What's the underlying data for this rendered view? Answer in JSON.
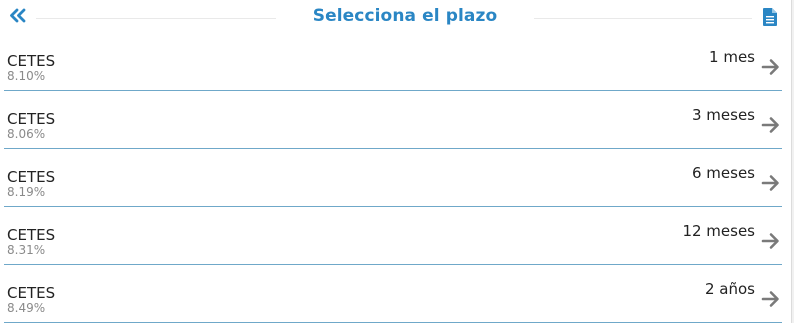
{
  "header": {
    "title": "Selecciona el plazo",
    "back_icon": "double-chevron-left-icon",
    "document_icon": "document-icon",
    "accent_color": "#2a86c4"
  },
  "items": [
    {
      "name": "CETES",
      "rate": "8.10%",
      "term": "1 mes"
    },
    {
      "name": "CETES",
      "rate": "8.06%",
      "term": "3 meses"
    },
    {
      "name": "CETES",
      "rate": "8.19%",
      "term": "6 meses"
    },
    {
      "name": "CETES",
      "rate": "8.31%",
      "term": "12 meses"
    },
    {
      "name": "CETES",
      "rate": "8.49%",
      "term": "2 años"
    }
  ],
  "row_arrow_icon": "arrow-right-icon",
  "divider_color": "#6fa8c9"
}
